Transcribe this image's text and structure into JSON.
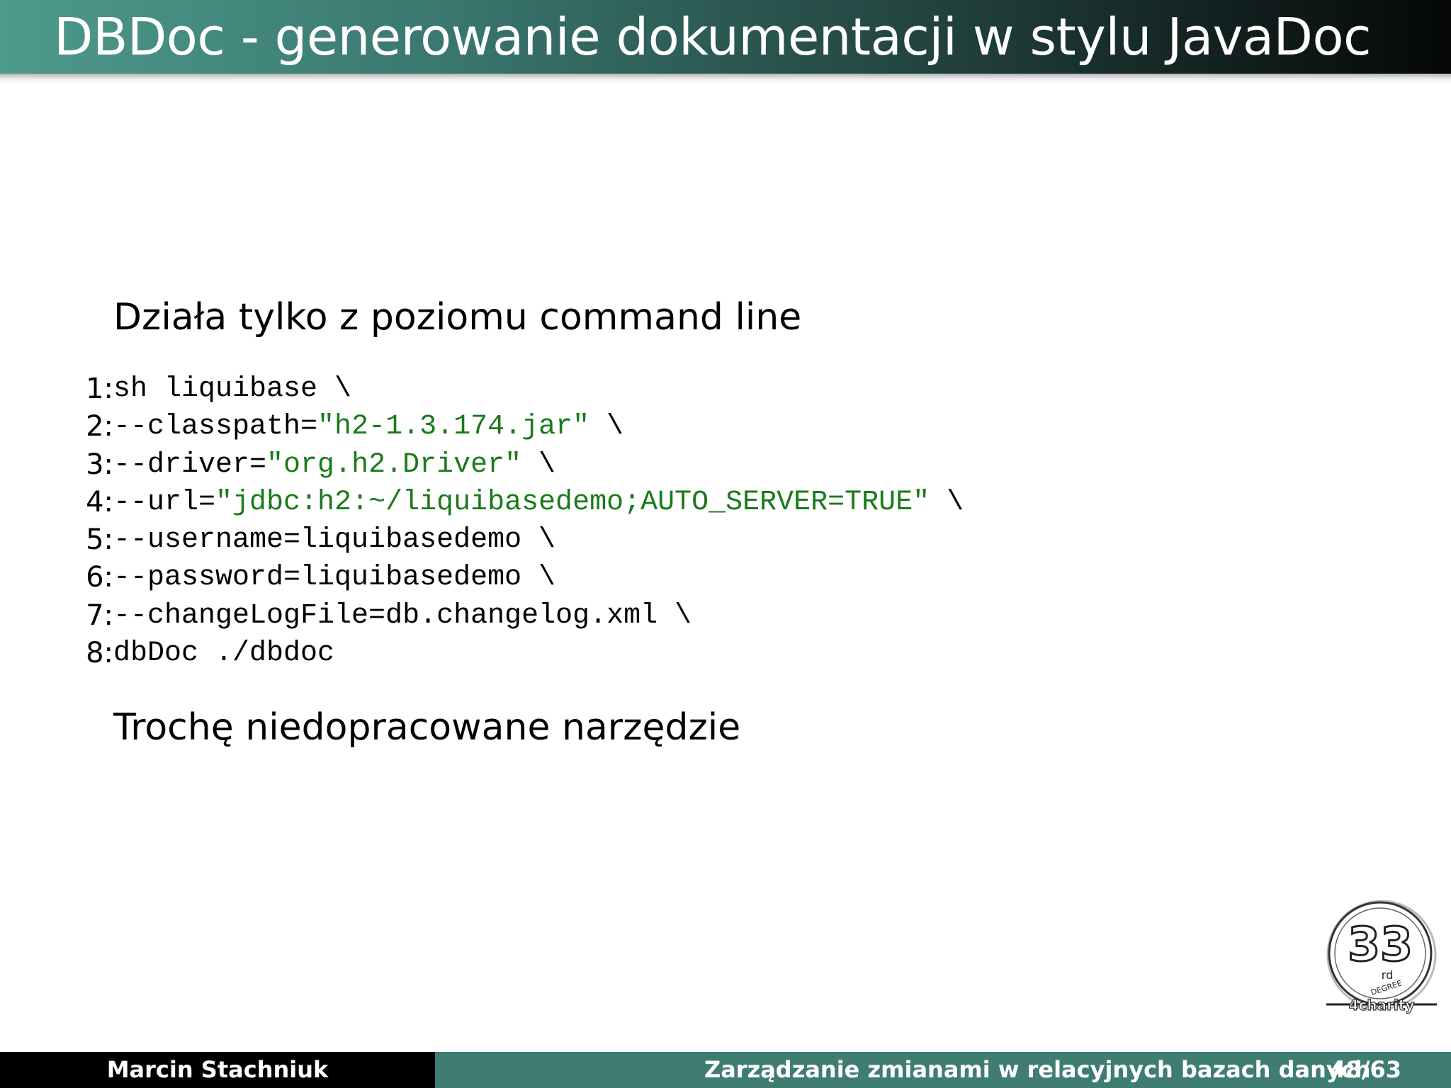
{
  "slide": {
    "title": "DBDoc - generowanie dokumentacji w stylu JavaDoc",
    "paragraph_1": "Działa tylko z poziomu command line",
    "paragraph_2": "Trochę niedopracowane narzędzie"
  },
  "code": {
    "lines": [
      {
        "num": "1:",
        "text": "sh liquibase \\",
        "str": "",
        "after": ""
      },
      {
        "num": "2:",
        "text": "--classpath=",
        "str": "\"h2-1.3.174.jar\"",
        "after": " \\"
      },
      {
        "num": "3:",
        "text": "--driver=",
        "str": "\"org.h2.Driver\"",
        "after": " \\"
      },
      {
        "num": "4:",
        "text": "--url=",
        "str": "\"jdbc:h2:~/liquibasedemo;AUTO_SERVER=TRUE\"",
        "after": " \\"
      },
      {
        "num": "5:",
        "text": "--username=liquibasedemo \\",
        "str": "",
        "after": ""
      },
      {
        "num": "6:",
        "text": "--password=liquibasedemo \\",
        "str": "",
        "after": ""
      },
      {
        "num": "7:",
        "text": "--changeLogFile=db.changelog.xml \\",
        "str": "",
        "after": ""
      },
      {
        "num": "8:",
        "text": "dbDoc ./dbdoc",
        "str": "",
        "after": ""
      }
    ]
  },
  "footer": {
    "author": "Marcin Stachniuk",
    "talk_title": "Zarządzanie zmianami w relacyjnych bazach danych",
    "page": "48/63"
  },
  "logo": {
    "number": "33",
    "suffix": "rd",
    "ring_text": "DEGREE",
    "tagline": "4charity"
  },
  "colors": {
    "header_start": "#4e9a8c",
    "header_end": "#050707",
    "footer_left": "#000000",
    "footer_right": "#3f7d73",
    "string_literal": "#1a7a1a"
  }
}
